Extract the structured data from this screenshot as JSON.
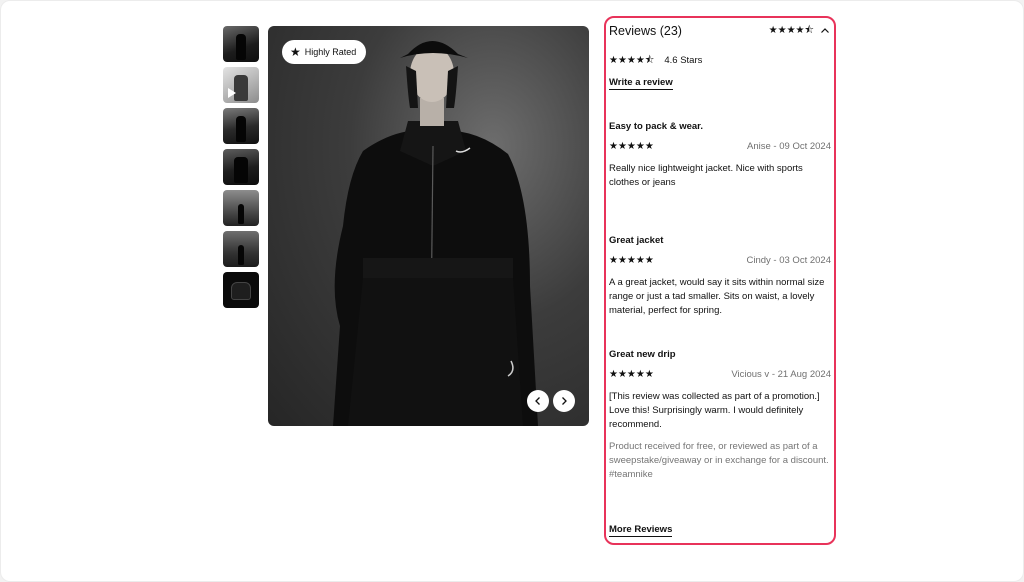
{
  "badge": {
    "label": "Highly Rated",
    "icon": "star-icon"
  },
  "reviews_panel": {
    "title": "Reviews (23)",
    "header_stars": "★★★★⯪",
    "rating_stars": "★★★★⯪",
    "rating_text": "4.6 Stars",
    "write_review": "Write a review",
    "more_reviews": "More Reviews",
    "accent_color": "#e8335a",
    "items": [
      {
        "title": "Easy to pack & wear.",
        "stars": "★★★★★",
        "author_date": "Anise - 09 Oct 2024",
        "body": "Really nice lightweight jacket. Nice with sports clothes or jeans"
      },
      {
        "title": "Great jacket",
        "stars": "★★★★★",
        "author_date": "Cindy - 03 Oct 2024",
        "body": "A a great jacket, would say it sits within normal size range or just a tad smaller. Sits on waist, a lovely material, perfect for spring."
      },
      {
        "title": "Great new drip",
        "stars": "★★★★★",
        "author_date": "Vicious v - 21 Aug 2024",
        "body": "[This review was collected as part of a promotion.] Love this! Surprisingly warm. I would definitely recommend.",
        "note": "Product received for free, or reviewed as part of a sweepstake/giveaway or in exchange for a discount.",
        "hashtag": "#teamnike"
      }
    ]
  }
}
